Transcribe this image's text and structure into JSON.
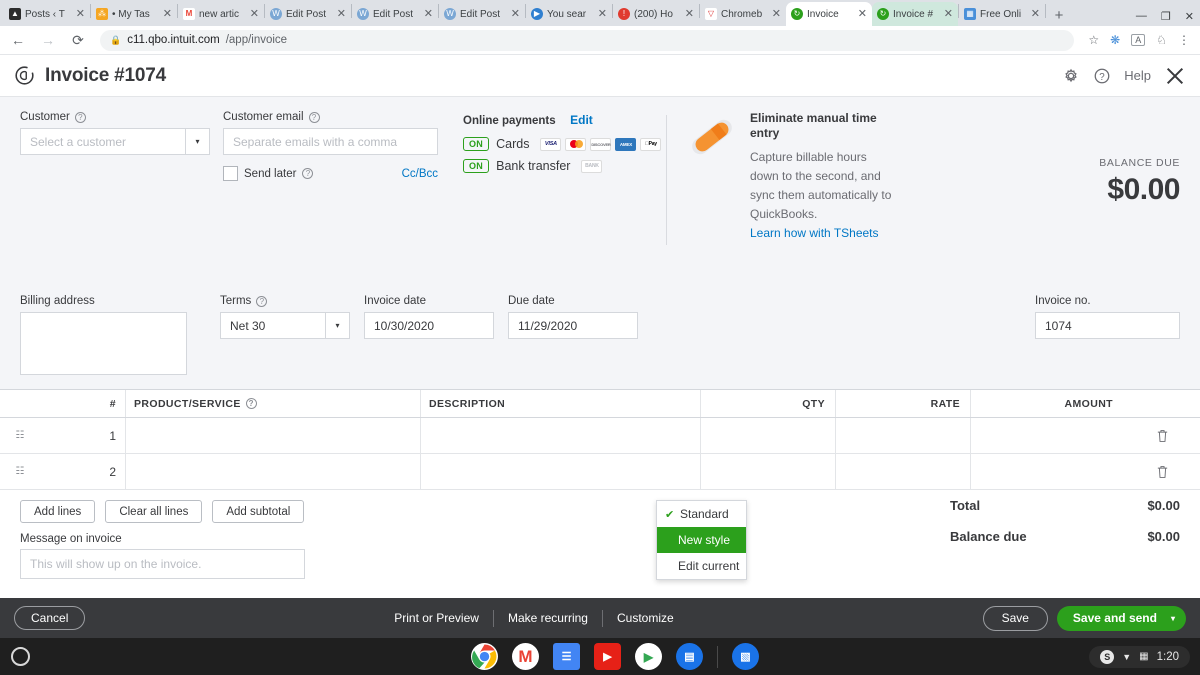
{
  "browser": {
    "tabs": [
      {
        "label": "Posts ‹ T",
        "favicon": "graduation-cap-icon",
        "color": "#2c2c2c",
        "glyph": "⌂",
        "state": "inactive"
      },
      {
        "label": "• My Tas",
        "favicon": "sitemap-icon",
        "color": "#f5a623",
        "glyph": "⁂",
        "state": "inactive"
      },
      {
        "label": "new artic",
        "favicon": "gmail-icon",
        "color": "#ffffff",
        "glyph": "M",
        "state": "inactive"
      },
      {
        "label": "Edit Post",
        "favicon": "wordpress-icon",
        "color": "#4a90d9",
        "glyph": "W",
        "state": "inactive"
      },
      {
        "label": "Edit Post",
        "favicon": "wordpress-icon",
        "color": "#4a90d9",
        "glyph": "W",
        "state": "inactive"
      },
      {
        "label": "Edit Post",
        "favicon": "wordpress-icon",
        "color": "#4a90d9",
        "glyph": "W",
        "state": "inactive"
      },
      {
        "label": "You sear",
        "favicon": "youtube-icon",
        "color": "#2f7fd0",
        "glyph": "▶",
        "state": "inactive"
      },
      {
        "label": "(200) Ho",
        "favicon": "notification-icon",
        "color": "#e03b2f",
        "glyph": "!",
        "state": "inactive"
      },
      {
        "label": "Chromeb",
        "favicon": "funnel-icon",
        "color": "#ffffff",
        "glyph": "▽",
        "state": "inactive"
      },
      {
        "label": "Invoice",
        "favicon": "quickbooks-icon",
        "color": "#2ca01c",
        "glyph": "↻",
        "state": "active"
      },
      {
        "label": "Invoice #",
        "favicon": "quickbooks-icon",
        "color": "#2ca01c",
        "glyph": "↻",
        "state": "semi"
      },
      {
        "label": "Free Onli",
        "favicon": "app-icon",
        "color": "#4a90d9",
        "glyph": "▦",
        "state": "inactive"
      }
    ],
    "new_tab_label": "+",
    "window_controls": {
      "minimize": "—",
      "maximize": "❐",
      "close": "✕"
    },
    "nav": {
      "back": "←",
      "forward": "→",
      "reload": "⟳"
    },
    "url_secure": "c11.qbo.intuit.com",
    "url_path": "/app/invoice",
    "lock_icon": "lock-icon",
    "toolbar_icons": [
      "star-icon",
      "extension-icon",
      "profile-icon",
      "puzzle-icon",
      "menu-icon"
    ]
  },
  "app_header": {
    "logo": "quickbooks-logo",
    "title": "Invoice #1074",
    "gear_icon": "gear-icon",
    "help_icon": "help-icon",
    "help_label": "Help",
    "close_icon": "close-icon"
  },
  "customer": {
    "label": "Customer",
    "placeholder": "Select a customer",
    "value": "",
    "caret": "▾"
  },
  "customer_email": {
    "label": "Customer email",
    "placeholder": "Separate emails with a comma",
    "value": "",
    "send_later_label": "Send later",
    "send_later_checked": false,
    "ccbcc_label": "Cc/Bcc"
  },
  "online_payments": {
    "title": "Online payments",
    "edit_label": "Edit",
    "cards": {
      "toggle": "ON",
      "label": "Cards",
      "logos": [
        {
          "name": "visa-logo",
          "text": "VISA",
          "bg": "#1a1f71"
        },
        {
          "name": "mastercard-logo",
          "text": "",
          "bg": "#eb7b1b"
        },
        {
          "name": "discover-logo",
          "text": "DISCOVER",
          "bg": "#e8e8e8"
        },
        {
          "name": "amex-logo",
          "text": "AMEX",
          "bg": "#2e77bc"
        },
        {
          "name": "applepay-logo",
          "text": "Pay",
          "bg": "#000000"
        }
      ]
    },
    "bank_transfer": {
      "toggle": "ON",
      "label": "Bank transfer",
      "logo_text": "BANK"
    }
  },
  "promo": {
    "icon": "pencil-icon",
    "heading": "Eliminate manual time entry",
    "body": "Capture billable hours down to the second, and sync them automatically to QuickBooks.",
    "link": "Learn how with TSheets"
  },
  "balance_due": {
    "label": "BALANCE DUE",
    "amount": "$0.00"
  },
  "billing_address": {
    "label": "Billing address",
    "value": ""
  },
  "terms": {
    "label": "Terms",
    "value": "Net 30",
    "caret": "▾"
  },
  "invoice_date": {
    "label": "Invoice date",
    "value": "10/30/2020"
  },
  "due_date": {
    "label": "Due date",
    "value": "11/29/2020"
  },
  "invoice_no": {
    "label": "Invoice no.",
    "value": "1074"
  },
  "line_table": {
    "headers": {
      "num": "#",
      "product": "PRODUCT/SERVICE",
      "description": "DESCRIPTION",
      "qty": "QTY",
      "rate": "RATE",
      "amount": "AMOUNT"
    },
    "rows": [
      {
        "num": "1",
        "product": "",
        "description": "",
        "qty": "",
        "rate": "",
        "amount": "",
        "grip_icon": "drag-handle-icon",
        "trash_icon": "trash-icon"
      },
      {
        "num": "2",
        "product": "",
        "description": "",
        "qty": "",
        "rate": "",
        "amount": "",
        "grip_icon": "drag-handle-icon",
        "trash_icon": "trash-icon"
      }
    ]
  },
  "line_buttons": {
    "add_lines": "Add lines",
    "clear_all_lines": "Clear all lines",
    "add_subtotal": "Add subtotal"
  },
  "message": {
    "label": "Message on invoice",
    "placeholder": "This will show up on the invoice.",
    "value": ""
  },
  "totals": {
    "total_label": "Total",
    "total_value": "$0.00",
    "balance_label": "Balance due",
    "balance_value": "$0.00"
  },
  "customize_menu": {
    "items": [
      {
        "label": "Standard",
        "checked": true,
        "selected": false
      },
      {
        "label": "New style",
        "checked": false,
        "selected": true
      },
      {
        "label": "Edit current",
        "checked": false,
        "selected": false
      }
    ],
    "check_glyph": "✔"
  },
  "action_bar": {
    "cancel": "Cancel",
    "print_preview": "Print or Preview",
    "make_recurring": "Make recurring",
    "customize": "Customize",
    "save": "Save",
    "save_and_send": "Save and send",
    "save_caret": "▾"
  },
  "shelf": {
    "launcher": "launcher-icon",
    "apps": [
      {
        "name": "chrome-icon",
        "glyph": "",
        "bg": "#ffffff"
      },
      {
        "name": "gmail-icon",
        "glyph": "M",
        "bg": "#ffffff"
      },
      {
        "name": "google-docs-icon",
        "glyph": "☰",
        "bg": "#4285f4"
      },
      {
        "name": "youtube-icon",
        "glyph": "▶",
        "bg": "#e62117"
      },
      {
        "name": "play-store-icon",
        "glyph": "▶",
        "bg": "#ffffff"
      },
      {
        "name": "google-keep-icon",
        "glyph": "▤",
        "bg": "#1a73e8"
      },
      {
        "name": "files-icon",
        "glyph": "▧",
        "bg": "#1a73e8"
      }
    ],
    "tray": {
      "account_glyph": "S",
      "wifi_icon": "wifi-icon",
      "battery_icon": "battery-icon",
      "time": "1:20"
    }
  },
  "colors": {
    "qb_green": "#2ca01c",
    "link_blue": "#0077c5",
    "dark_bar": "#393a3d",
    "form_bg": "#f4f5f8"
  }
}
